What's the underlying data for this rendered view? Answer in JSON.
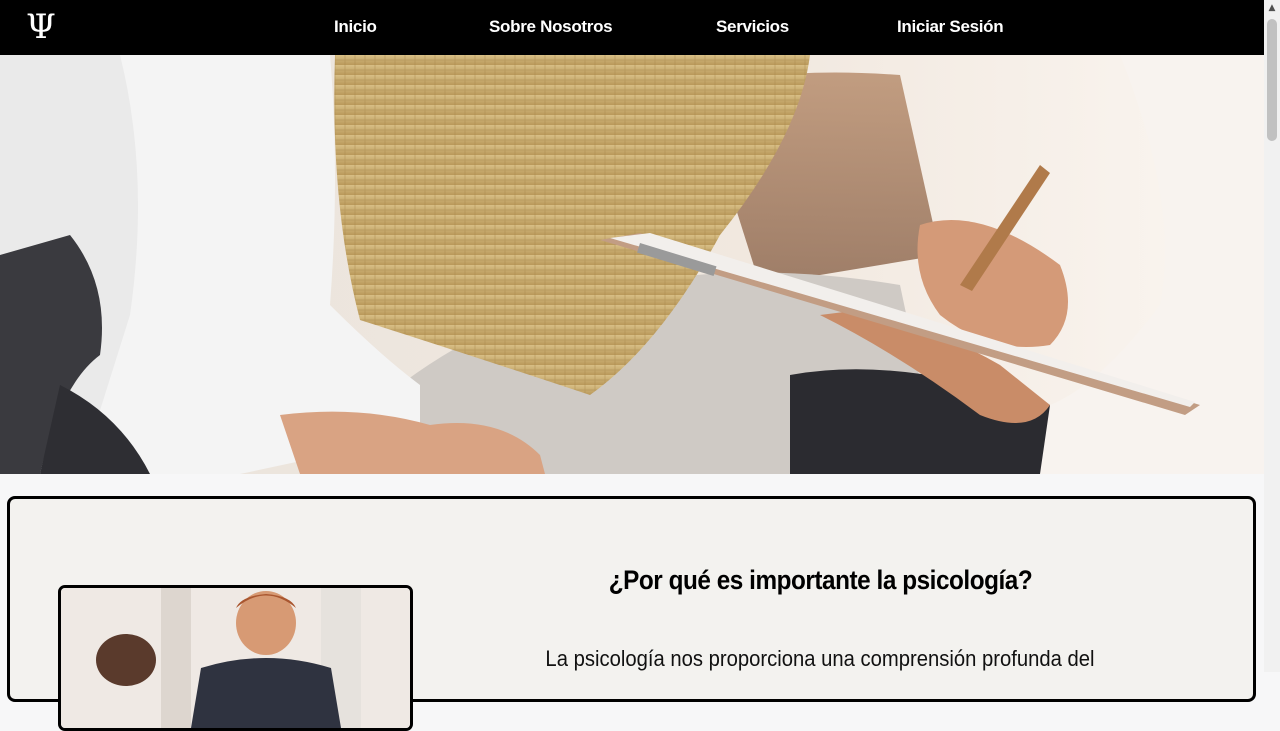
{
  "nav": {
    "logo": "Ψ",
    "links": [
      {
        "label": "Inicio"
      },
      {
        "label": "Sobre Nosotros"
      },
      {
        "label": "Servicios"
      },
      {
        "label": "Iniciar Sesión"
      }
    ]
  },
  "hero": {
    "alt": "Sesión de terapia: paciente y psicóloga con portapapeles"
  },
  "section": {
    "title": "¿Por qué es importante la psicología?",
    "body": "La psicología nos proporciona una comprensión profunda del"
  },
  "scrollbar": {
    "up_arrow": "▲"
  },
  "colors": {
    "navbar": "#000000",
    "card_background": "#f3f2ef",
    "page_background": "#f7f7f8"
  }
}
